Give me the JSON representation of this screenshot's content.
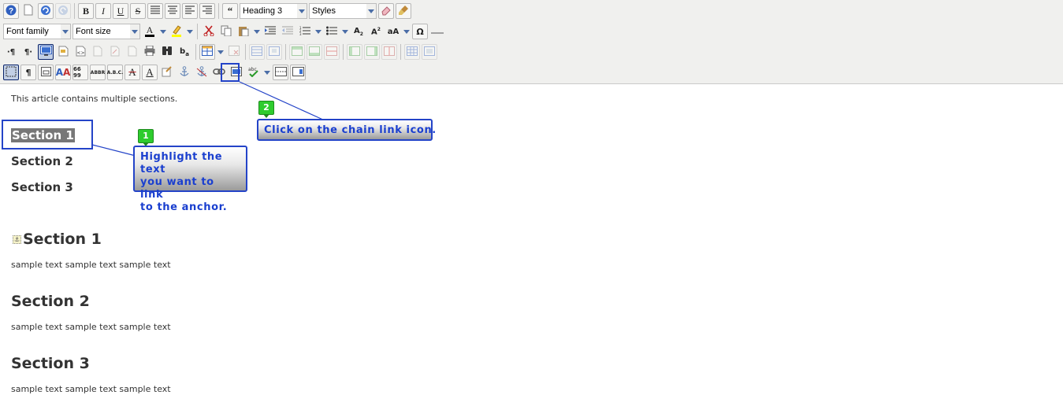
{
  "toolbar": {
    "format_select": "Heading 3",
    "styles_select": "Styles",
    "font_family_select": "Font family",
    "font_size_select": "Font size",
    "row1": {
      "bold": "B",
      "italic": "I",
      "underline": "U",
      "strike": "S"
    },
    "row4": {
      "pilcrow": "¶",
      "abbr": "ABBR",
      "acronym": "A.B.C.",
      "quote": "66 99"
    },
    "accent_colors": {
      "text_color": "#000000",
      "highlight_color": "#ffff00"
    }
  },
  "editor": {
    "intro": "This article contains multiple sections.",
    "toc": [
      "Section 1",
      "Section 2",
      "Section 3"
    ],
    "sections": [
      {
        "heading": "Section 1",
        "body": "sample text sample text sample text"
      },
      {
        "heading": "Section 2",
        "body": "sample text sample text sample text"
      },
      {
        "heading": "Section 3",
        "body": "sample text sample text sample text"
      }
    ]
  },
  "callouts": [
    {
      "number": "1",
      "lines": [
        "Highlight the text",
        "you want to link",
        "to the anchor."
      ]
    },
    {
      "number": "2",
      "lines": [
        "Click on the chain link icon."
      ]
    }
  ],
  "icons": [
    "help-icon",
    "new-document-icon",
    "undo-icon",
    "redo-icon",
    "blockquote-icon",
    "eraser-icon",
    "paintbrush-icon",
    "cut-icon",
    "copy-icon",
    "paste-icon",
    "indent-icon",
    "outdent-icon",
    "numbered-list-icon",
    "bullet-list-icon",
    "subscript-icon",
    "superscript-icon",
    "change-case-icon",
    "special-char-icon",
    "horizontal-rule-icon",
    "ltr-icon",
    "rtl-icon",
    "preview-icon",
    "template-icon",
    "source-icon",
    "print-icon",
    "find-icon",
    "replace-icon",
    "table-icon",
    "visual-aid-icon",
    "anchor-icon",
    "link-icon",
    "unlink-icon",
    "image-icon",
    "spellcheck-icon",
    "layer-icon"
  ]
}
